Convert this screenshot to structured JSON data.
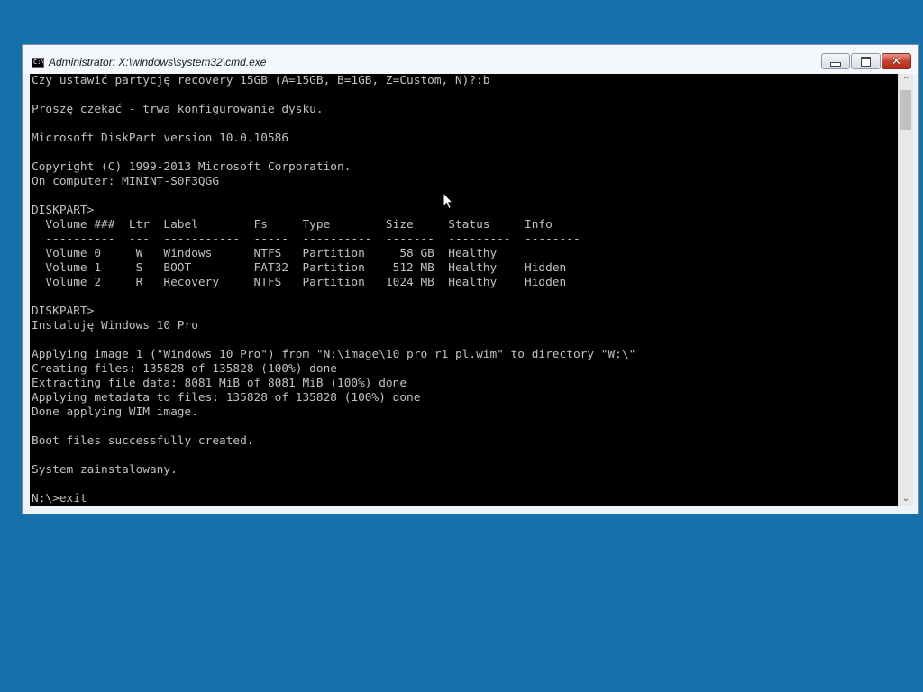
{
  "window": {
    "title": "Administrator: X:\\windows\\system32\\cmd.exe",
    "icon_text": "C:\\"
  },
  "console": {
    "lines": [
      "Czy ustawić partycję recovery 15GB (A=15GB, B=1GB, Z=Custom, N)?:b",
      "",
      "Proszę czekać - trwa konfigurowanie dysku.",
      "",
      "Microsoft DiskPart version 10.0.10586",
      "",
      "Copyright (C) 1999-2013 Microsoft Corporation.",
      "On computer: MININT-S0F3QGG",
      "",
      "DISKPART>",
      "  Volume ###  Ltr  Label        Fs     Type        Size     Status     Info",
      "  ----------  ---  -----------  -----  ----------  -------  ---------  --------",
      "  Volume 0     W   Windows      NTFS   Partition     58 GB  Healthy",
      "  Volume 1     S   BOOT         FAT32  Partition    512 MB  Healthy    Hidden",
      "  Volume 2     R   Recovery     NTFS   Partition   1024 MB  Healthy    Hidden",
      "",
      "DISKPART>",
      "Instaluję Windows 10 Pro",
      "",
      "Applying image 1 (\"Windows 10 Pro\") from \"N:\\image\\10_pro_r1_pl.wim\" to directory \"W:\\\"",
      "Creating files: 135828 of 135828 (100%) done",
      "Extracting file data: 8081 MiB of 8081 MiB (100%) done",
      "Applying metadata to files: 135828 of 135828 (100%) done",
      "Done applying WIM image.",
      "",
      "Boot files successfully created.",
      "",
      "System zainstalowany.",
      "",
      "N:\\>exit"
    ]
  },
  "colors": {
    "desktop": "#1670aa",
    "console_bg": "#000000",
    "console_fg": "#c0c0c0",
    "close_button": "#c4412f"
  },
  "icons": {
    "minimize": "minimize-icon",
    "maximize": "maximize-icon",
    "close": "close-icon",
    "scroll_up": "chevron-up-icon",
    "scroll_down": "chevron-down-icon",
    "cursor": "mouse-pointer-icon"
  }
}
